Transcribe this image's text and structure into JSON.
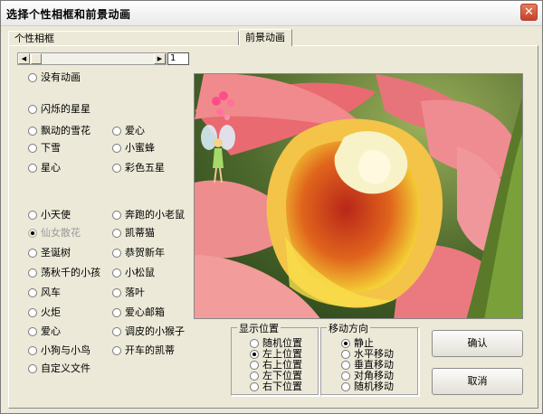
{
  "window": {
    "title": "选择个性相框和前景动画",
    "close_glyph": "✕"
  },
  "tabs": [
    {
      "label": "个性相框"
    },
    {
      "label": "前景动画"
    }
  ],
  "scrollbar": {
    "left_arrow": "◀",
    "right_arrow": "▶",
    "value": "1"
  },
  "animations": {
    "col1": [
      "没有动画",
      "闪烁的星星",
      "飘动的雪花",
      "下雪",
      "星心",
      "小天使",
      "仙女散花",
      "圣诞树",
      "荡秋千的小孩",
      "风车",
      "火炬",
      "爱心",
      "小狗与小鸟",
      "自定义文件"
    ],
    "col2": [
      "爱心",
      "小蜜蜂",
      "彩色五星",
      "奔跑的小老鼠",
      "凯蒂猫",
      "恭贺新年",
      "小松鼠",
      "落叶",
      "爱心邮箱",
      "调皮的小猴子",
      "开车的凯蒂"
    ]
  },
  "position_group": {
    "label": "显示位置",
    "options": [
      "随机位置",
      "左上位置",
      "右上位置",
      "左下位置",
      "右下位置"
    ],
    "selected": "左上位置"
  },
  "motion_group": {
    "label": "移动方向",
    "options": [
      "静止",
      "水平移动",
      "垂直移动",
      "对角移动",
      "随机移动"
    ],
    "selected": "静止"
  },
  "buttons": {
    "ok": "确认",
    "cancel": "取消"
  },
  "preview": {
    "icon": "flower-photo-with-fairy"
  }
}
